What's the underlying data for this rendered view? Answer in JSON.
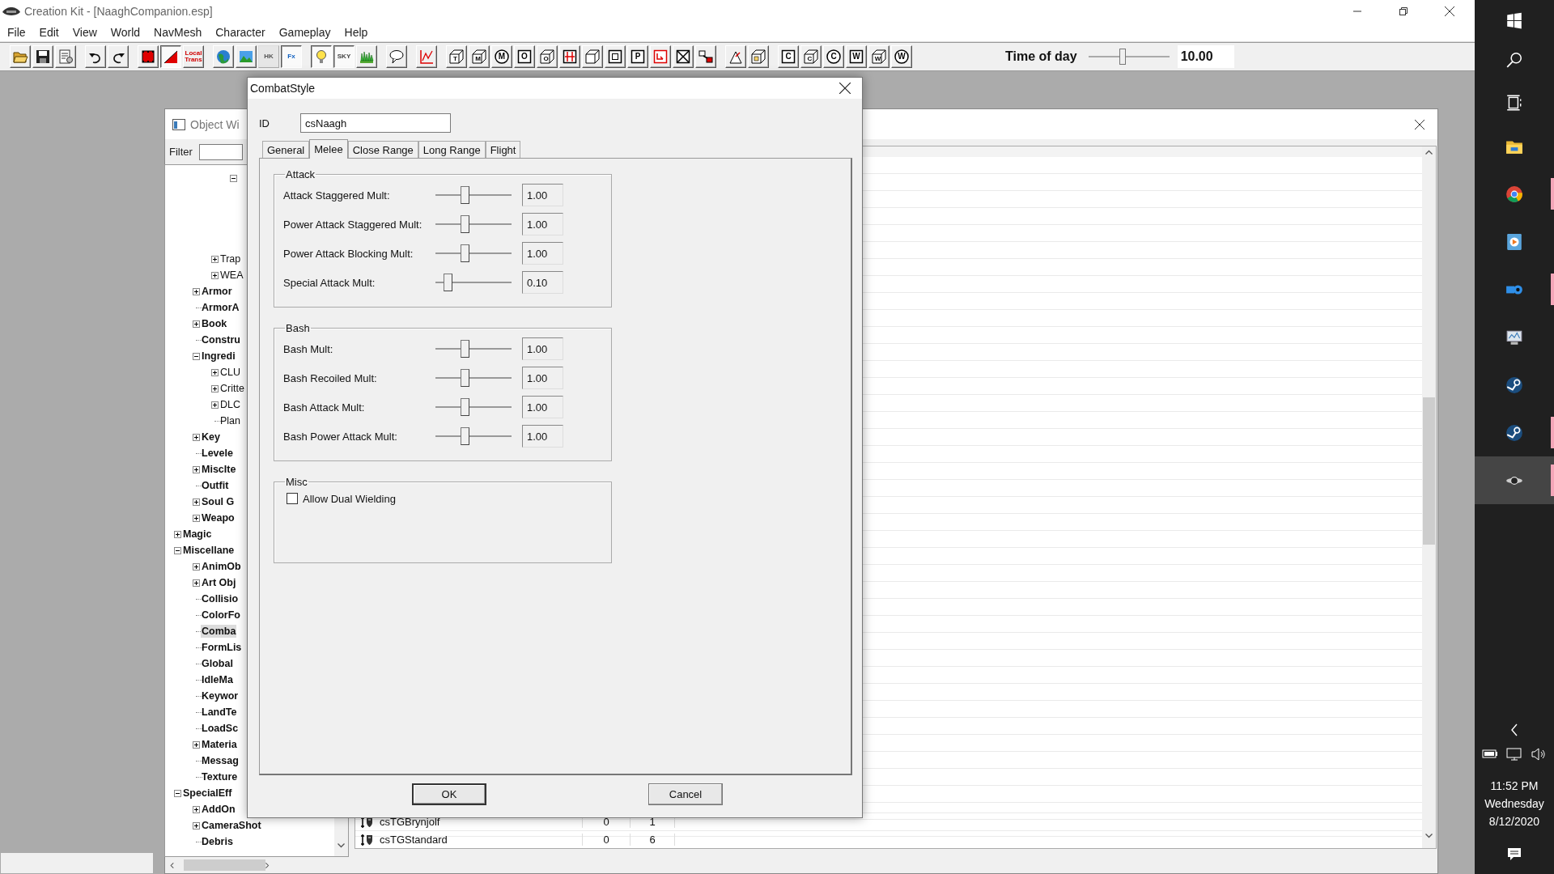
{
  "window": {
    "title": "Creation Kit - [NaaghCompanion.esp]"
  },
  "menu": [
    "File",
    "Edit",
    "View",
    "World",
    "NavMesh",
    "Character",
    "Gameplay",
    "Help"
  ],
  "toolbar": {
    "groups": [
      [
        {
          "kind": "open",
          "pressed": false,
          "disabled": false
        },
        {
          "kind": "save",
          "pressed": false,
          "disabled": false
        },
        {
          "kind": "settings",
          "pressed": false,
          "disabled": false
        }
      ],
      [
        {
          "kind": "undo",
          "pressed": false,
          "disabled": false
        },
        {
          "kind": "redo",
          "pressed": false,
          "disabled": false
        }
      ],
      [
        {
          "kind": "grid-square",
          "pressed": false,
          "disabled": false
        },
        {
          "kind": "triangle",
          "pressed": true,
          "disabled": false
        },
        {
          "kind": "label",
          "glyph": "Local Trans",
          "color": "#d00000",
          "pressed": false,
          "disabled": false
        }
      ],
      [
        {
          "kind": "globe",
          "pressed": false,
          "disabled": false
        },
        {
          "kind": "landscape",
          "pressed": false,
          "disabled": false
        },
        {
          "kind": "label",
          "glyph": "HK",
          "color": "#555555",
          "pressed": false,
          "disabled": true
        },
        {
          "kind": "label",
          "glyph": "Fx",
          "color": "#1060c0",
          "pressed": true,
          "disabled": false
        }
      ],
      [
        {
          "kind": "bulb",
          "pressed": true,
          "disabled": false
        },
        {
          "kind": "label",
          "glyph": "SKY",
          "color": "#444444",
          "pressed": true,
          "disabled": false
        },
        {
          "kind": "grass",
          "pressed": false,
          "disabled": false
        }
      ],
      [
        {
          "kind": "bubble",
          "pressed": false,
          "disabled": false
        }
      ],
      [
        {
          "kind": "chart",
          "pressed": false,
          "disabled": false
        }
      ],
      [
        {
          "kind": "cube",
          "glyph": "T",
          "pressed": false,
          "disabled": false
        },
        {
          "kind": "cube",
          "glyph": "M",
          "pressed": false,
          "disabled": false
        },
        {
          "kind": "circled",
          "glyph": "M",
          "pressed": false,
          "disabled": false
        },
        {
          "kind": "boxed",
          "glyph": "O",
          "pressed": false,
          "disabled": false
        },
        {
          "kind": "cube",
          "glyph": "O",
          "pressed": false,
          "disabled": false
        },
        {
          "kind": "split",
          "pressed": false,
          "disabled": false
        },
        {
          "kind": "cube",
          "pressed": false,
          "disabled": false
        },
        {
          "kind": "square",
          "pressed": false,
          "disabled": false
        },
        {
          "kind": "boxed",
          "glyph": "P",
          "pressed": false,
          "disabled": false
        },
        {
          "kind": "arrow-box",
          "pressed": false,
          "disabled": false
        },
        {
          "kind": "cross-box",
          "pressed": false,
          "disabled": false
        },
        {
          "kind": "link",
          "pressed": false,
          "disabled": false
        }
      ],
      [
        {
          "kind": "pick",
          "pressed": false,
          "disabled": false
        },
        {
          "kind": "cube-page",
          "pressed": false,
          "disabled": false
        }
      ],
      [
        {
          "kind": "boxed",
          "glyph": "C",
          "pressed": false,
          "disabled": false
        },
        {
          "kind": "cube",
          "glyph": "C",
          "pressed": false,
          "disabled": false
        },
        {
          "kind": "circled",
          "glyph": "C",
          "pressed": false,
          "disabled": false
        },
        {
          "kind": "boxed",
          "glyph": "W",
          "pressed": false,
          "disabled": false
        },
        {
          "kind": "cube",
          "glyph": "W",
          "pressed": false,
          "disabled": false
        },
        {
          "kind": "circled",
          "glyph": "W",
          "pressed": false,
          "disabled": false
        }
      ]
    ],
    "time_of_day": {
      "label": "Time of day",
      "level": 0.42,
      "value": "10.00"
    }
  },
  "object_window": {
    "title": "Object Wi",
    "filter": {
      "label": "Filter"
    },
    "tree": [
      {
        "kind": "continued",
        "children": [
          {
            "kind": "continued",
            "children": [
              {
                "kind": "continued",
                "children": [
                  {
                    "kind": "group",
                    "expanded": true
                  }
                ]
              },
              {
                "kind": "group",
                "label": "Trap",
                "expanded": false,
                "selected": false
              },
              {
                "kind": "group",
                "label": "WEA",
                "expanded": false,
                "selected": false
              }
            ]
          },
          {
            "kind": "group",
            "label": "Armor",
            "expanded": false,
            "selected": false
          },
          {
            "kind": "leaf",
            "label": "ArmorA",
            "selected": false
          },
          {
            "kind": "group",
            "label": "Book",
            "expanded": false,
            "selected": false
          },
          {
            "kind": "leaf",
            "label": "Constru",
            "selected": false
          },
          {
            "kind": "group",
            "label": "Ingredi",
            "expanded": true,
            "selected": false,
            "children": [
              {
                "kind": "group",
                "label": "CLU",
                "expanded": false,
                "selected": false
              },
              {
                "kind": "group",
                "label": "Critte",
                "expanded": false,
                "selected": false
              },
              {
                "kind": "group",
                "label": "DLC",
                "expanded": false,
                "selected": false
              },
              {
                "kind": "leaf",
                "label": "Plan",
                "selected": false
              }
            ]
          },
          {
            "kind": "group",
            "label": "Key",
            "expanded": false,
            "selected": false
          },
          {
            "kind": "leaf",
            "label": "Levele",
            "selected": false
          },
          {
            "kind": "group",
            "label": "MiscIte",
            "expanded": false,
            "selected": false
          },
          {
            "kind": "leaf",
            "label": "Outfit",
            "selected": false
          },
          {
            "kind": "group",
            "label": "Soul G",
            "expanded": false,
            "selected": false
          },
          {
            "kind": "group",
            "label": "Weapo",
            "expanded": false,
            "selected": false
          }
        ]
      },
      {
        "kind": "group",
        "label": "Magic",
        "expanded": false,
        "selected": false
      },
      {
        "kind": "group",
        "label": "Miscellane",
        "expanded": true,
        "selected": false,
        "children": [
          {
            "kind": "group",
            "label": "AnimOb",
            "expanded": false,
            "selected": false
          },
          {
            "kind": "group",
            "label": "Art Obj",
            "expanded": false,
            "selected": false
          },
          {
            "kind": "leaf",
            "label": "Collisio",
            "selected": false
          },
          {
            "kind": "leaf",
            "label": "ColorFo",
            "selected": false
          },
          {
            "kind": "leaf",
            "label": "Comba",
            "selected": true
          },
          {
            "kind": "leaf",
            "label": "FormLis",
            "selected": false
          },
          {
            "kind": "leaf",
            "label": "Global",
            "selected": false
          },
          {
            "kind": "leaf",
            "label": "IdleMa",
            "selected": false
          },
          {
            "kind": "leaf",
            "label": "Keywor",
            "selected": false
          },
          {
            "kind": "leaf",
            "label": "LandTe",
            "selected": false
          },
          {
            "kind": "leaf",
            "label": "LoadSc",
            "selected": false
          },
          {
            "kind": "group",
            "label": "Materia",
            "expanded": false,
            "selected": false
          },
          {
            "kind": "leaf",
            "label": "Messag",
            "selected": false
          },
          {
            "kind": "leaf",
            "label": "Texture",
            "selected": false
          }
        ]
      },
      {
        "kind": "group",
        "label": "SpecialEff",
        "expanded": true,
        "selected": false,
        "children": [
          {
            "kind": "group",
            "label": "AddOn",
            "expanded": false,
            "selected": false
          },
          {
            "kind": "group",
            "label": "CameraShot",
            "expanded": false,
            "selected": false
          },
          {
            "kind": "leaf",
            "label": "Debris",
            "selected": false
          }
        ]
      }
    ],
    "list": {
      "rows": [
        {
          "cells": [
            "csTGBrynjolf",
            "0",
            "1"
          ]
        },
        {
          "cells": [
            "csTGStandard",
            "0",
            "6"
          ]
        }
      ]
    }
  },
  "dialog": {
    "title": "CombatStyle",
    "id": {
      "label": "ID",
      "value": "csNaagh"
    },
    "tabs": [
      {
        "label": "General",
        "selected": false
      },
      {
        "label": "Melee",
        "selected": true
      },
      {
        "label": "Close Range",
        "selected": false
      },
      {
        "label": "Long Range",
        "selected": false
      },
      {
        "label": "Flight",
        "selected": false
      }
    ],
    "groups": [
      {
        "title": "Attack",
        "kind": "sliders",
        "rows": [
          {
            "label": "Attack Staggered Mult:",
            "level": 0.38,
            "value": "1.00"
          },
          {
            "label": "Power Attack Staggered Mult:",
            "level": 0.38,
            "value": "1.00"
          },
          {
            "label": "Power Attack Blocking Mult:",
            "level": 0.38,
            "value": "1.00"
          },
          {
            "label": "Special Attack Mult:",
            "level": 0.16,
            "value": "0.10"
          }
        ]
      },
      {
        "title": "Bash",
        "kind": "sliders",
        "rows": [
          {
            "label": "Bash Mult:",
            "level": 0.38,
            "value": "1.00"
          },
          {
            "label": "Bash Recoiled Mult:",
            "level": 0.38,
            "value": "1.00"
          },
          {
            "label": "Bash Attack Mult:",
            "level": 0.38,
            "value": "1.00"
          },
          {
            "label": "Bash Power Attack Mult:",
            "level": 0.38,
            "value": "1.00"
          }
        ]
      },
      {
        "title": "Misc",
        "kind": "checks",
        "rows": [
          {
            "label": "Allow Dual Wielding",
            "checked": false
          }
        ]
      }
    ],
    "buttons": [
      {
        "label": "OK",
        "kind": "default"
      },
      {
        "label": "Cancel",
        "kind": "normal"
      }
    ]
  },
  "taskbar": {
    "items": [
      {
        "kind": "start",
        "running": false,
        "selected": false
      },
      {
        "kind": "search",
        "running": false,
        "selected": false
      },
      {
        "kind": "task-view",
        "running": false,
        "selected": false
      },
      {
        "kind": "folder",
        "running": false,
        "selected": false
      },
      {
        "kind": "browser",
        "running": true,
        "selected": false
      },
      {
        "kind": "media",
        "running": false,
        "selected": false
      },
      {
        "kind": "cloud",
        "running": true,
        "selected": false
      },
      {
        "kind": "monitor",
        "running": false,
        "selected": false
      },
      {
        "kind": "steam",
        "running": false,
        "selected": false
      },
      {
        "kind": "steam",
        "running": true,
        "selected": false
      },
      {
        "kind": "kit",
        "running": true,
        "selected": true
      }
    ],
    "clock": {
      "time": "11:52 PM",
      "day": "Wednesday",
      "date": "8/12/2020"
    }
  }
}
